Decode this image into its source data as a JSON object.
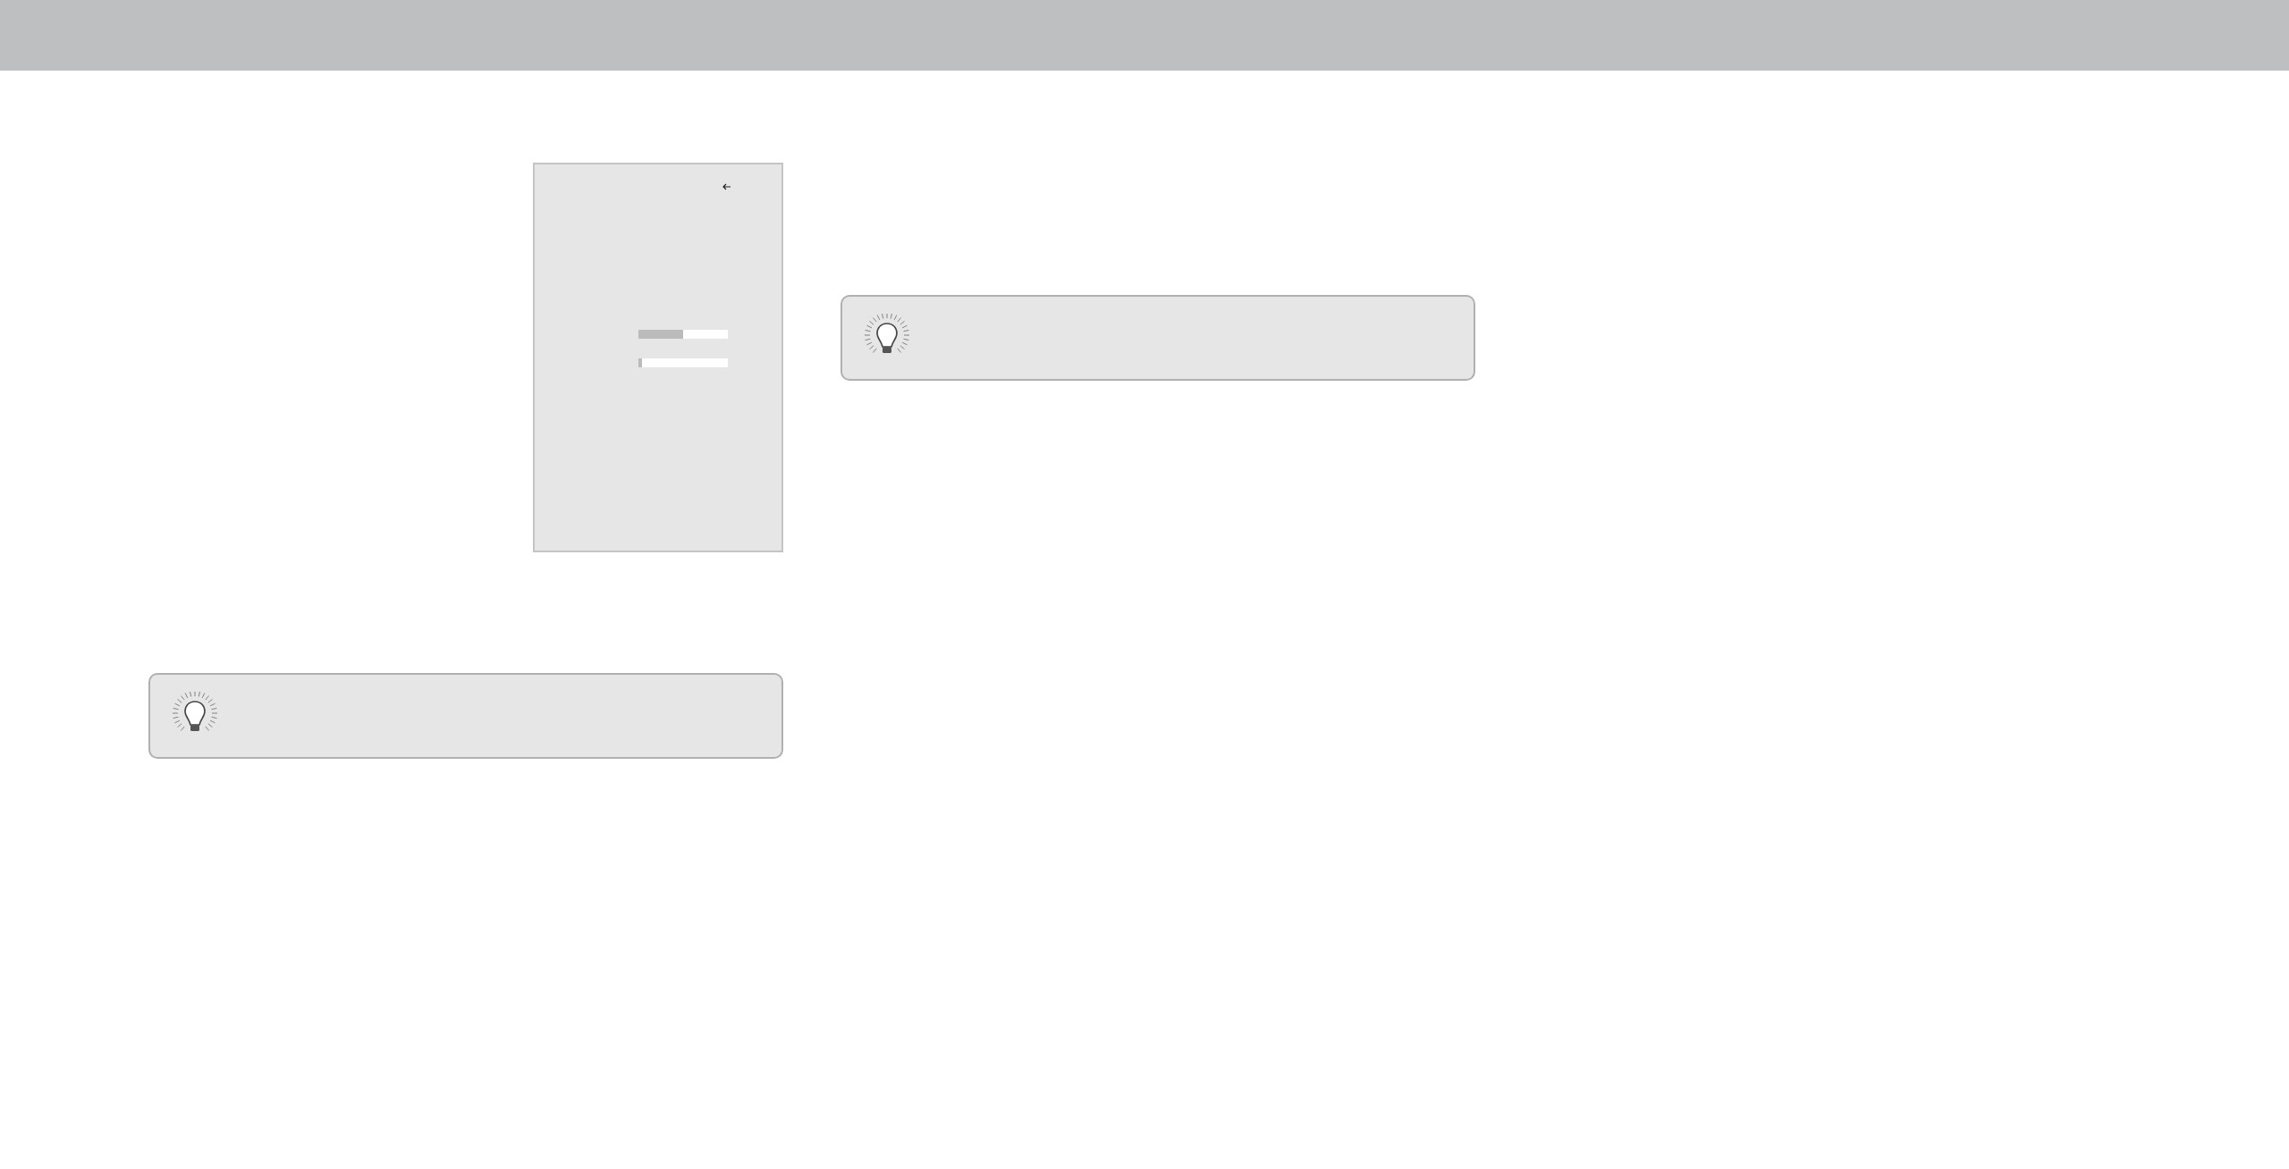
{
  "menu_panel": {
    "sliders": [
      {
        "level": 0.5
      },
      {
        "level": 0.04
      }
    ]
  }
}
